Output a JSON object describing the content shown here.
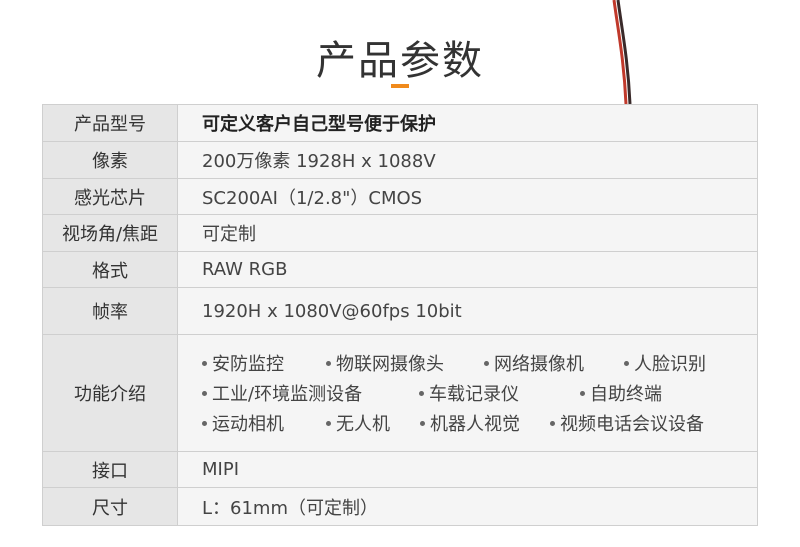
{
  "title": "产品参数",
  "rows": [
    {
      "label": "产品型号",
      "value": "可定义客户自己型号便于保护"
    },
    {
      "label": "像素",
      "value": "200万像素   1928H x 1088V"
    },
    {
      "label": "感光芯片",
      "value": "SC200AI（1/2.8\"）CMOS"
    },
    {
      "label": "视场角/焦距",
      "value": "可定制"
    },
    {
      "label": "格式",
      "value": "RAW RGB"
    },
    {
      "label": "帧率",
      "value": "1920H x 1080V@60fps 10bit"
    }
  ],
  "features": {
    "label": "功能介绍",
    "lines": [
      [
        "安防监控",
        "物联网摄像头",
        "网络摄像机",
        "人脸识别"
      ],
      [
        "工业/环境监测设备",
        "车载记录仪",
        "自助终端"
      ],
      [
        "运动相机",
        "无人机",
        "机器人视觉",
        "视频电话会议设备"
      ]
    ]
  },
  "rows_after": [
    {
      "label": "接口",
      "value": "MIPI"
    },
    {
      "label": "尺寸",
      "value": "L：61mm（可定制）"
    }
  ],
  "colors": {
    "accent": "#f08a1c",
    "label_bg": "#e6e6e6",
    "value_bg": "#f5f5f5",
    "border": "#cfcfcf"
  }
}
